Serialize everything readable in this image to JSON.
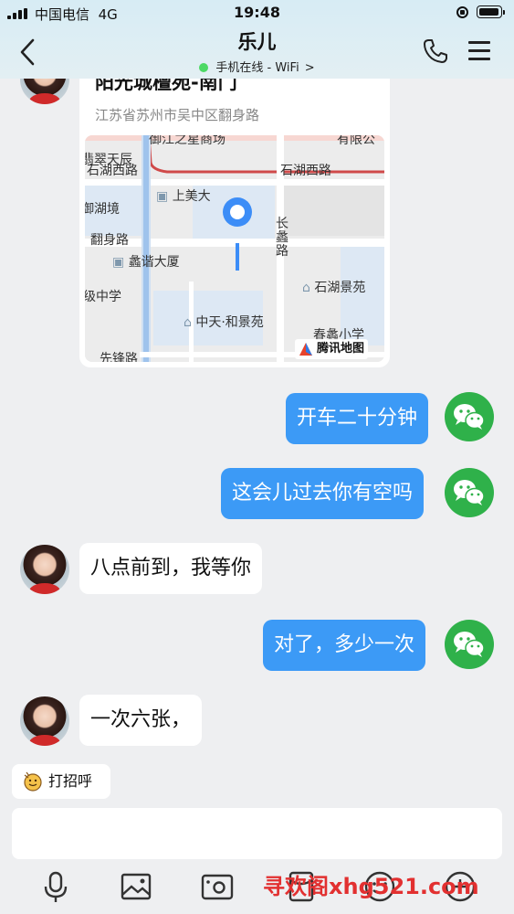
{
  "status_bar": {
    "carrier": "中国电信",
    "network": "4G",
    "time": "19:48"
  },
  "header": {
    "contact_name": "乐儿",
    "status_text": "手机在线 - WiFi"
  },
  "location_card": {
    "title": "阳光城檀苑-南门",
    "address": "江苏省苏州市吴中区翻身路",
    "map_labels": [
      "御江之星商场",
      "有限公",
      "翡翠天辰",
      "石湖西路",
      "石湖西路",
      "上美大",
      "御湖境",
      "长蠡路",
      "翻身路",
      "蠡谐大厦",
      "石湖景苑",
      "级中学",
      "中天·和景苑",
      "先锋路",
      "春蠡小学"
    ],
    "map_provider": "腾讯地图"
  },
  "messages": [
    {
      "from": "me",
      "text": "开车二十分钟"
    },
    {
      "from": "me",
      "text": "这会儿过去你有空吗"
    },
    {
      "from": "them",
      "text": "八点前到，我等你"
    },
    {
      "from": "me",
      "text": "对了，多少一次"
    },
    {
      "from": "them",
      "text": "一次六张，"
    }
  ],
  "greeting_button": "打招呼",
  "composer": {
    "value": ""
  },
  "watermark": "寻欢阁xhg521.com",
  "colors": {
    "my_bubble": "#3c9af6",
    "their_bubble": "#ffffff",
    "wechat_badge": "#2fb14a",
    "online_dot": "#4cd964",
    "watermark": "#e23030"
  }
}
